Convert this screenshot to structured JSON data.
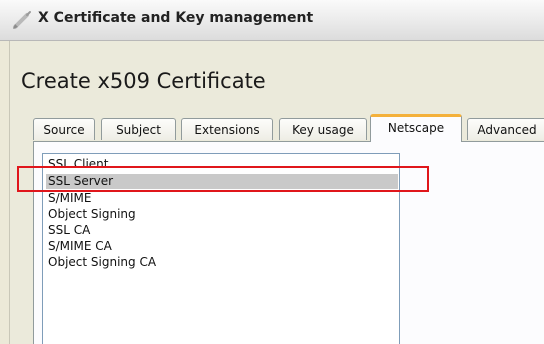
{
  "window": {
    "title": "X Certificate and Key management"
  },
  "dialog": {
    "heading": "Create x509 Certificate"
  },
  "tabs": [
    {
      "label": "Source",
      "active": false
    },
    {
      "label": "Subject",
      "active": false
    },
    {
      "label": "Extensions",
      "active": false
    },
    {
      "label": "Key usage",
      "active": false
    },
    {
      "label": "Netscape",
      "active": true
    },
    {
      "label": "Advanced",
      "active": false
    }
  ],
  "cert_types": {
    "items": [
      {
        "label": "SSL Client",
        "selected": false
      },
      {
        "label": "SSL Server",
        "selected": true
      },
      {
        "label": "S/MIME",
        "selected": false
      },
      {
        "label": "Object Signing",
        "selected": false
      },
      {
        "label": "SSL CA",
        "selected": false
      },
      {
        "label": "S/MIME CA",
        "selected": false
      },
      {
        "label": "Object Signing CA",
        "selected": false
      }
    ]
  },
  "colors": {
    "annotation_box": "#e0161b",
    "active_tab_accent": "#f4b13b",
    "selection": "#c9c9c9"
  },
  "icons": {
    "app": "pencil-icon"
  }
}
